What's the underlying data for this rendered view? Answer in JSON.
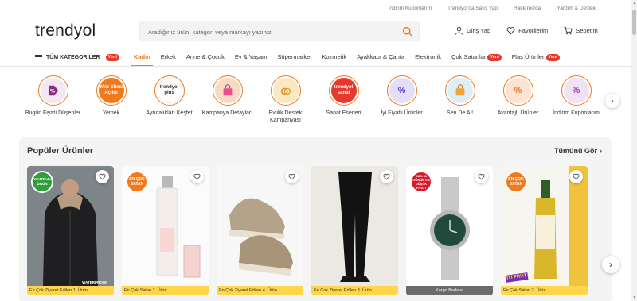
{
  "top_links": [
    "İndirim Kuponlarım",
    "Trendyol'da Satış Yap",
    "Hakkımızda",
    "Yardım & Destek"
  ],
  "logo": "trendyol",
  "search": {
    "placeholder": "Aradığınız ürün, kategori veya markayı yazınız"
  },
  "header_actions": {
    "login": "Giriş Yap",
    "favorites": "Favorilerim",
    "cart": "Sepetim"
  },
  "nav": {
    "all_categories": "TÜM KATEGORİLER",
    "new_badge": "Yeni",
    "items": [
      "Kadın",
      "Erkek",
      "Anne & Çocuk",
      "Ev & Yaşam",
      "Süpermarket",
      "Kozmetik",
      "Ayakkabı & Çanta",
      "Elektronik"
    ],
    "best_sellers": "Çok Satanlar",
    "flash": "Flaş Ürünler"
  },
  "stories": [
    {
      "label": "Bugün Fiyatı Düşenler",
      "text": "",
      "color": "#f4e7f2"
    },
    {
      "label": "Yemek",
      "text": "Web Sitesi Açıldı",
      "color": "#f27a1a"
    },
    {
      "label": "Ayrıcalıkları Keşfet",
      "text": "trendyol plus",
      "color": "#ffffff"
    },
    {
      "label": "Kampanya Detayları",
      "text": "",
      "color": "#f7d9c4"
    },
    {
      "label": "Evlilik Destek Kampanyası",
      "text": "",
      "color": "#fbe7c0"
    },
    {
      "label": "Sanat Eserleri",
      "text": "trendyol sanat",
      "color": "#e8372c"
    },
    {
      "label": "İyi Fiyatlı Ürünler",
      "text": "%",
      "color": "#e3defa"
    },
    {
      "label": "Sen De Al!",
      "text": "",
      "color": "#dceff9"
    },
    {
      "label": "Avantajlı Ürünler",
      "text": "%",
      "color": "#fde3d2"
    },
    {
      "label": "İndirim Kuponlarım",
      "text": "%",
      "color": "#f1e1f5"
    }
  ],
  "popular": {
    "title": "Popüler Ürünler",
    "see_all": "Tümünü Gör",
    "cards": [
      {
        "badge": "AVANTAJLI ÜRÜN",
        "strip": "En Çok Ziyaret Edilen 1. Ürün",
        "strip_style": "yellow"
      },
      {
        "badge": "EN ÇOK SATAN",
        "strip": "En Çok Satan 1. Ürün",
        "strip_style": "yellow"
      },
      {
        "badge": "",
        "strip": "En Çok Ziyaret Edilen 4. Ürün",
        "strip_style": "yellow"
      },
      {
        "badge": "",
        "strip": "En Çok Ziyaret Edilen 3. Ürün",
        "strip_style": "yellow"
      },
      {
        "badge": "SON 30 GÜNÜN EN DÜŞÜK FİYATI",
        "strip": "Kargo Bedava",
        "strip_style": "gray"
      },
      {
        "badge": "EN ÇOK SATAN",
        "strip": "En Çok Satan 2. Ürün",
        "strip_style": "yellow"
      }
    ],
    "overlay_text": {
      "waterproof": "WATERPROOF",
      "iyi_fiyat": "İYİ FİYAT"
    }
  }
}
